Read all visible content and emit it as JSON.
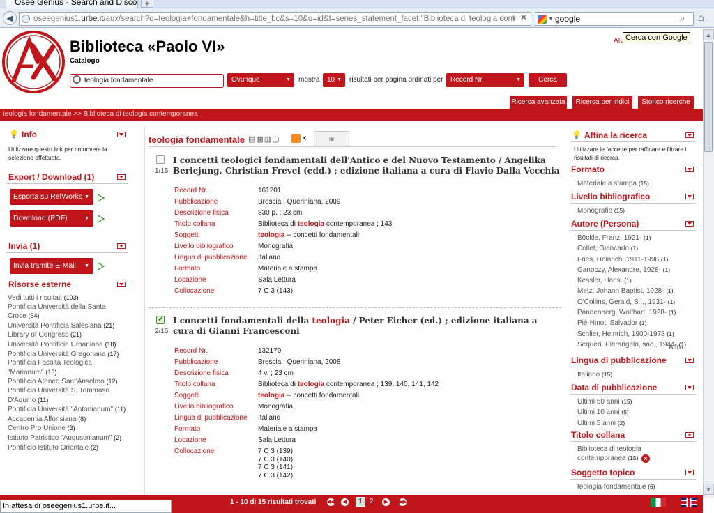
{
  "browser": {
    "tab_title": "Osee Genius - Search and Discovery",
    "new_tab": "+",
    "url_prefix": "oseegenius1.",
    "url_domain": "urbe.it",
    "url_rest": "/aux/search?q=teologia+fondamentale&h=title_bc&s=10&o=id&f=series_statement_facet:\"Biblioteca di teologia cont",
    "search_value": "google",
    "tooltip": "Cerca con Google"
  },
  "header": {
    "title": "Biblioteca «Paolo VI»",
    "subtitle": "Catalogo",
    "aiuto": "AIU",
    "query": "teologia fondamentale",
    "scope": "Ovunque",
    "mostra_label": "mostra",
    "count": "10",
    "results_label": "risultati per pagina ordinati per",
    "order": "Record Nr.",
    "search_button": "Cerca",
    "btn_advanced": "Ricerca avanzata",
    "btn_index": "Ricerca per indici",
    "btn_history": "Storico ricerche",
    "breadcrumb": "teologia fondamentale >>  Biblioteca di teologia contemporanea"
  },
  "left": {
    "info_title": "Info",
    "info_text": "Utilizzare questo link per rimuovere la selezione effettuata.",
    "export_title": "Export / Download (1)",
    "export_refworks": "Esporta su RefWorks",
    "download_pdf": "Download (PDF)",
    "invia_title": "Invia (1)",
    "invia_email": "Invia tramite E-Mail",
    "ext_title": "Risorse esterne",
    "ext_items": [
      {
        "label": "Vedi tutti i risultati",
        "count": "(193)"
      },
      {
        "label": "Pontificia Università della Santa Croce",
        "count": "(54)"
      },
      {
        "label": "Università Pontificia Salesiana",
        "count": "(21)"
      },
      {
        "label": "Library of Congress",
        "count": "(21)"
      },
      {
        "label": "Università Pontificia Urbaniana",
        "count": "(18)"
      },
      {
        "label": "Pontificia Università Gregoriana",
        "count": "(17)"
      },
      {
        "label": "Pontificia Facoltà Teologica \"Marianum\"",
        "count": "(13)"
      },
      {
        "label": "Pontificio Ateneo Sant'Anselmo",
        "count": "(12)"
      },
      {
        "label": "Pontificia Università S. Tommaso D'Aquino",
        "count": "(11)"
      },
      {
        "label": "Pontificia Università \"Antonianum\"",
        "count": "(11)"
      },
      {
        "label": "Accademia Alfonsiana",
        "count": "(8)"
      },
      {
        "label": "Centro Pro Unione",
        "count": "(3)"
      },
      {
        "label": "Istituto Patristico \"Augustinianum\"",
        "count": "(2)"
      },
      {
        "label": "Pontificio Istituto Orientale",
        "count": "(2)"
      }
    ]
  },
  "main": {
    "title": "teologia fondamentale",
    "close": "×",
    "records": [
      {
        "pos": "1/15",
        "title_a": "I concetti teologici fondamentali dell'Antico e del Nuovo Testamento / Angelika Berlejung, Christian Frevel (edd.) ; edizione italiana a cura di Flavio Dalla Vecchia",
        "title_hl": "",
        "title_b": "",
        "fields": {
          "record_label": "Record Nr.",
          "record": "161201",
          "pub_label": "Pubblicazione",
          "pub": "Brescia : Queriniana, 2009",
          "desc_label": "Descrizione fisica",
          "desc": "830 p. ; 23 cm",
          "collana_label": "Titolo collana",
          "collana_a": "Biblioteca di ",
          "collana_hl": "teologia",
          "collana_b": " contemporanea ; 143",
          "sogg_label": "Soggetti",
          "sogg_hl": "teologia",
          "sogg_b": " -- concetti fondamentali",
          "liv_label": "Livello bibliografico",
          "liv": "Monografia",
          "lingua_label": "Lingua di pubblicazione",
          "lingua": "Italiano",
          "formato_label": "Formato",
          "formato": "Materiale a stampa",
          "loc_label": "Locazione",
          "loc": "Sala Lettura",
          "coll_label": "Collocazione",
          "coll": [
            "7 C 3 (143)"
          ]
        }
      },
      {
        "pos": "2/15",
        "title_a": "I concetti fondamentali della ",
        "title_hl": "teologia",
        "title_b": " / Peter Eicher (ed.) ; edizione italiana a cura di Gianni Francesconi",
        "fields": {
          "record_label": "Record Nr.",
          "record": "132179",
          "pub_label": "Pubblicazione",
          "pub": "Brescia : Queriniana, 2008",
          "desc_label": "Descrizione fisica",
          "desc": "4 v. ; 23 cm",
          "collana_label": "Titolo collana",
          "collana_a": "Biblioteca di ",
          "collana_hl": "teologia",
          "collana_b": " contemporanea ; 139, 140, 141, 142",
          "sogg_label": "Soggetti",
          "sogg_hl": "teologia",
          "sogg_b": " -- concetti fondamentali",
          "liv_label": "Livello bibliografico",
          "liv": "Monografia",
          "lingua_label": "Lingua di pubblicazione",
          "lingua": "Italiano",
          "formato_label": "Formato",
          "formato": "Materiale a stampa",
          "loc_label": "Locazione",
          "loc": "Sala Lettura",
          "coll_label": "Collocazione",
          "coll": [
            "7 C 3 (139)",
            "7 C 3 (140)",
            "7 C 3 (141)",
            "7 C 3 (142)"
          ]
        }
      }
    ]
  },
  "right": {
    "title": "Affina la ricerca",
    "intro": "Utilizzare le faccette per raffinare e filtrare i risultati di ricerca.",
    "formato_title": "Formato",
    "formato_items": [
      {
        "label": "Materiale a stampa",
        "count": "(15)"
      }
    ],
    "livello_title": "Livello bibliografico",
    "livello_items": [
      {
        "label": "Monografie",
        "count": "(15)"
      }
    ],
    "autore_title": "Autore (Persona)",
    "autore_items": [
      {
        "label": "Böckle, Franz, 1921-",
        "count": "(1)"
      },
      {
        "label": "Collet, Giancarlo",
        "count": "(1)"
      },
      {
        "label": "Fries, Heinrich, 1911-1998",
        "count": "(1)"
      },
      {
        "label": "Ganoczy, Alexandre, 1928-",
        "count": "(1)"
      },
      {
        "label": "Kessler, Hans.",
        "count": "(1)"
      },
      {
        "label": "Metz, Johann Baptist, 1928-",
        "count": "(1)"
      },
      {
        "label": "O'Collins, Gerald, S.I., 1931-",
        "count": "(1)"
      },
      {
        "label": "Pannenberg, Wolfhart, 1928-",
        "count": "(1)"
      },
      {
        "label": "Piè-Ninot, Salvador",
        "count": "(1)"
      },
      {
        "label": "Schlier, Heinrich, 1900-1978",
        "count": "(1)"
      },
      {
        "label": "Sequeri, Pierangelo, sac., 1944-",
        "count": "(1)"
      }
    ],
    "altro": "Altro...",
    "lingua_title": "Lingua di pubblicazione",
    "lingua_items": [
      {
        "label": "Italiano",
        "count": "(15)"
      }
    ],
    "data_title": "Data di pubblicazione",
    "data_items": [
      {
        "label": "Ultimi 50 anni",
        "count": "(15)"
      },
      {
        "label": "Ultimi 10 anni",
        "count": "(5)"
      },
      {
        "label": "Ultimi 5 anni",
        "count": "(2)"
      }
    ],
    "collana_title": "Titolo collana",
    "collana_item": "Biblioteca di teologia contemporanea",
    "collana_count": "(15)",
    "topico_title": "Soggetto topico",
    "topico_items": [
      {
        "label": "teologia fondamentale",
        "count": "(6)"
      }
    ]
  },
  "footer": {
    "status": "In attesa di oseegenius1.urbe.it...",
    "pagination": "1 - 10 di 15 risultati trovati",
    "page1": "1",
    "page2": "2"
  },
  "colors": {
    "accent": "#c0151a",
    "link_grey": "#555555"
  }
}
